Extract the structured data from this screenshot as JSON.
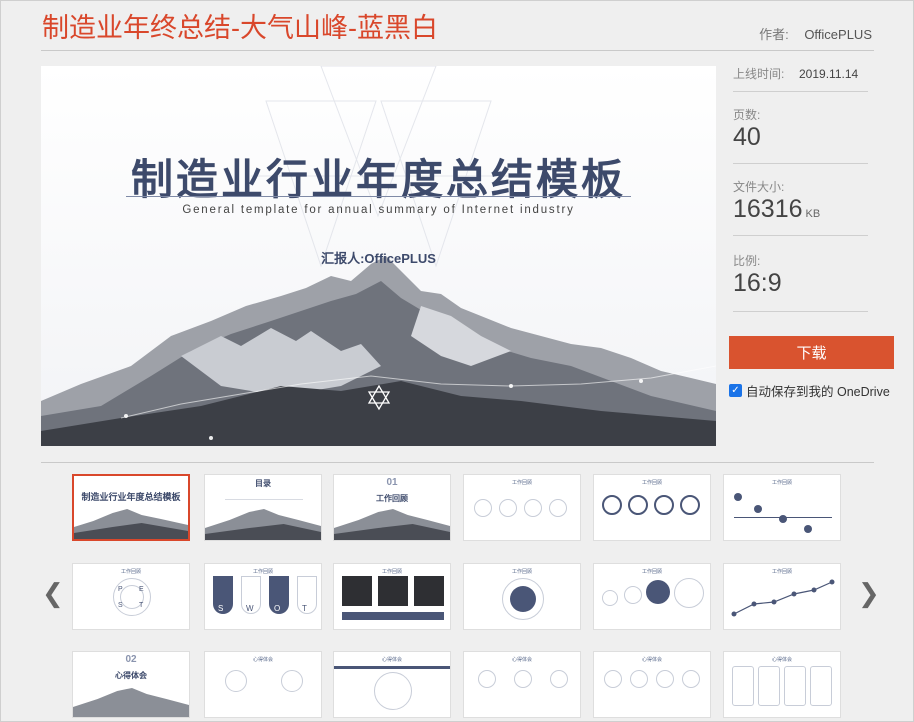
{
  "title": "制造业年终总结-大气山峰-蓝黑白",
  "author": {
    "label": "作者:",
    "value": "OfficePLUS"
  },
  "preview": {
    "main_title": "制造业行业年度总结模板",
    "subtitle": "General template for annual summary of Internet industry",
    "reporter": "汇报人:OfficePLUS"
  },
  "meta": {
    "online_label": "上线时间:",
    "online_value": "2019.11.14",
    "pages_label": "页数:",
    "pages_value": "40",
    "size_label": "文件大小:",
    "size_value": "16316",
    "size_unit": "KB",
    "ratio_label": "比例:",
    "ratio_value": "16:9"
  },
  "download_label": "下载",
  "autosave_label": "自动保存到我的 OneDrive",
  "icons": {
    "prev": "chevron-left-icon",
    "next": "chevron-right-icon",
    "check": "checkbox-checked-icon"
  },
  "colors": {
    "accent": "#d9472b",
    "button": "#d9532f",
    "slide_navy": "#3d4a6b"
  },
  "thumbnails": {
    "t1": "制造业行业年度总结模板",
    "t2": "目录",
    "t3_num": "01",
    "t3": "工作回顾",
    "t4": "工作回顾",
    "t5": "工作回顾",
    "t6": "工作回顾",
    "t7": "工作回顾",
    "t8": "工作回顾",
    "t9": "工作回顾",
    "t10": "工作回顾",
    "t11": "工作回顾",
    "t12": "工作回顾",
    "t13_num": "02",
    "t13": "心得体会",
    "t14": "心得体会",
    "t15": "心得体会",
    "t16": "心得体会",
    "t17": "心得体会",
    "t18": "心得体会",
    "pest": [
      "P",
      "E",
      "S",
      "T"
    ],
    "swot": [
      "S",
      "W",
      "O",
      "T"
    ]
  }
}
